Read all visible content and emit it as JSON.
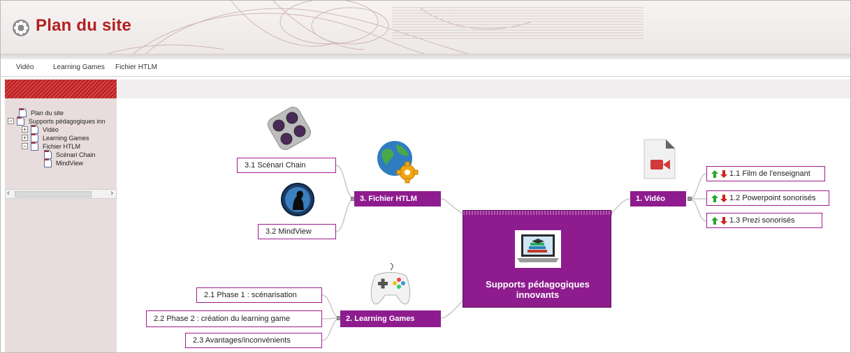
{
  "header": {
    "title": "Plan du site"
  },
  "menubar": {
    "items": [
      "Vidéo",
      "Learning Games",
      "Fichier HTLM"
    ]
  },
  "sidebar": {
    "tree": [
      {
        "label": "Plan du site",
        "expander": ""
      },
      {
        "label": "Supports pédagogiques inn",
        "expander": "−"
      },
      {
        "label": "Vidéo",
        "expander": "+"
      },
      {
        "label": "Learning Games",
        "expander": "+"
      },
      {
        "label": "Fichier HTLM",
        "expander": "−"
      },
      {
        "label": "Scénari Chain",
        "expander": ""
      },
      {
        "label": "MindView",
        "expander": ""
      }
    ],
    "scroll_left": "‹",
    "scroll_right": "›"
  },
  "mindmap": {
    "center": {
      "title": "Supports pédagogiques innovants"
    },
    "video": {
      "label": "1. Vidéo",
      "children": [
        "1.1  Film de l'enseignant",
        "1.2  Powerpoint sonorisés",
        "1.3  Prezi sonorisés"
      ]
    },
    "games": {
      "label": "2. Learning Games",
      "children": [
        "2.1  Phase 1 : scénarisation",
        "2.2  Phase 2 : création du learning game",
        "2.3  Avantages/inconvénients"
      ]
    },
    "htlm": {
      "label": "3. Fichier HTLM",
      "children": [
        "3.1  Scénari Chain",
        "3.2  MindView"
      ]
    }
  },
  "colors": {
    "accent_red": "#b22020",
    "node_purple": "#8e1c8e",
    "sidebar_bg": "#e8dcdc"
  },
  "icons": [
    "logo-flower-icon",
    "page-icon",
    "video-file-icon",
    "globe-gear-icon",
    "gamepad-icon",
    "laptop-books-icon",
    "tablet-apps-icon",
    "silhouette-icon",
    "arrow-up-icon",
    "arrow-down-icon"
  ]
}
